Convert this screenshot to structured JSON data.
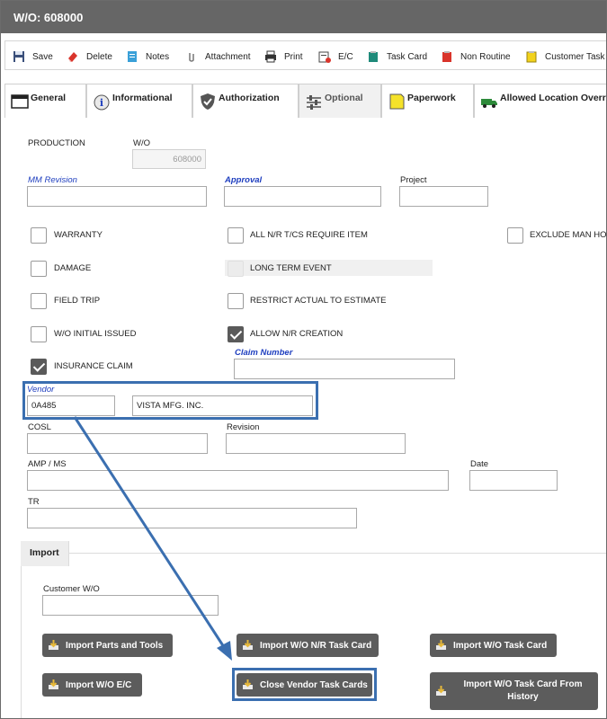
{
  "window": {
    "title": "W/O: 608000"
  },
  "toolbar": {
    "save": "Save",
    "delete": "Delete",
    "notes": "Notes",
    "attachment": "Attachment",
    "print": "Print",
    "ec": "E/C",
    "task_card": "Task Card",
    "non_routine": "Non Routine",
    "customer_task": "Customer Task C"
  },
  "tabs": {
    "general": "General",
    "informational": "Informational",
    "authorization": "Authorization",
    "optional": "Optional",
    "paperwork": "Paperwork",
    "allowed_location": "Allowed Location Overr"
  },
  "form": {
    "production_label": "PRODUCTION",
    "wo_label": "W/O",
    "wo_value": "608000",
    "mm_revision_label": "MM Revision",
    "approval_label": "Approval",
    "project_label": "Project",
    "checkboxes": {
      "warranty": "WARRANTY",
      "all_nr": "ALL N/R T/CS REQUIRE ITEM",
      "exclude_man": "EXCLUDE MAN HOU",
      "damage": "DAMAGE",
      "long_term": "LONG TERM EVENT",
      "field_trip": "FIELD TRIP",
      "restrict": "RESTRICT ACTUAL TO ESTIMATE",
      "wo_initial": "W/O INITIAL ISSUED",
      "allow_nr": "ALLOW N/R CREATION",
      "insurance": "INSURANCE CLAIM"
    },
    "claim_number_label": "Claim Number",
    "vendor_label": "Vendor",
    "vendor_code": "0A485",
    "vendor_name": "VISTA MFG. INC.",
    "cosl_label": "COSL",
    "revision_label": "Revision",
    "amp_label": "AMP / MS",
    "date_label": "Date",
    "tr_label": "TR"
  },
  "import": {
    "title": "Import",
    "customer_wo_label": "Customer W/O",
    "buttons": {
      "parts_tools": "Import Parts and Tools",
      "wo_nr": "Import W/O N/R Task Card",
      "wo_task": "Import W/O Task Card",
      "wo_ec": "Import W/O E/C",
      "close_vendor": "Close Vendor Task Cards",
      "from_history": "Import W/O Task Card From History"
    }
  },
  "colors": {
    "title_bar": "#666666",
    "button": "#5c5c5c",
    "highlight": "#3b6fb0",
    "link_label": "#1f3fbf"
  }
}
